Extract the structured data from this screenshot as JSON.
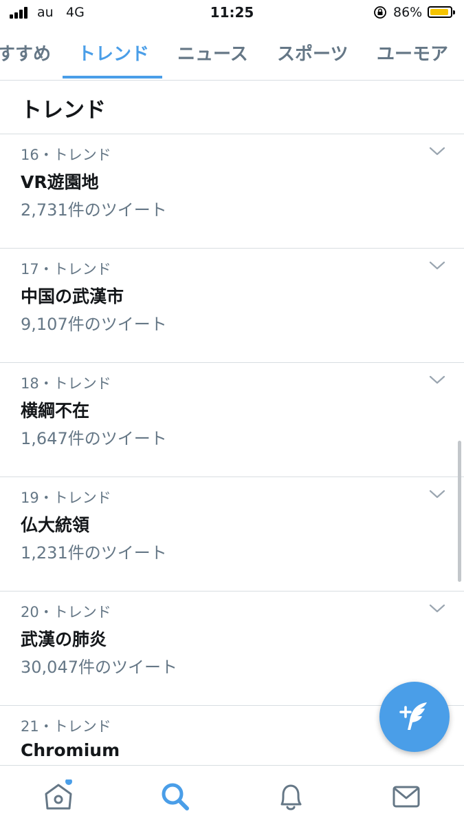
{
  "status_bar": {
    "carrier": "au",
    "network": "4G",
    "time": "11:25",
    "battery_percent": "86%",
    "battery_level": 0.86,
    "battery_color": "#f5c400"
  },
  "tabs": [
    {
      "label": "すすめ",
      "active": false
    },
    {
      "label": "トレンド",
      "active": true
    },
    {
      "label": "ニュース",
      "active": false
    },
    {
      "label": "スポーツ",
      "active": false
    },
    {
      "label": "ユーモア",
      "active": false
    }
  ],
  "section": {
    "title": "トレンド"
  },
  "trends": [
    {
      "meta": "16・トレンド",
      "name": "VR遊園地",
      "count": "2,731件のツイート"
    },
    {
      "meta": "17・トレンド",
      "name": "中国の武漢市",
      "count": "9,107件のツイート"
    },
    {
      "meta": "18・トレンド",
      "name": "横綱不在",
      "count": "1,647件のツイート"
    },
    {
      "meta": "19・トレンド",
      "name": "仏大統領",
      "count": "1,231件のツイート"
    },
    {
      "meta": "20・トレンド",
      "name": "武漢の肺炎",
      "count": "30,047件のツイート"
    },
    {
      "meta": "21・トレンド",
      "name": "Chromium",
      "count": ""
    }
  ],
  "icons": {
    "trend_menu": "chevron-down-icon",
    "compose": "compose-tweet-icon",
    "nav": [
      "home-icon",
      "search-icon",
      "bell-icon",
      "mail-icon"
    ]
  },
  "colors": {
    "accent": "#4a9ee8",
    "secondary_text": "#657786",
    "primary_text": "#14171a",
    "divider": "#d8dde1"
  },
  "bottom_nav": {
    "home_has_notification_dot": true,
    "active": "search"
  }
}
